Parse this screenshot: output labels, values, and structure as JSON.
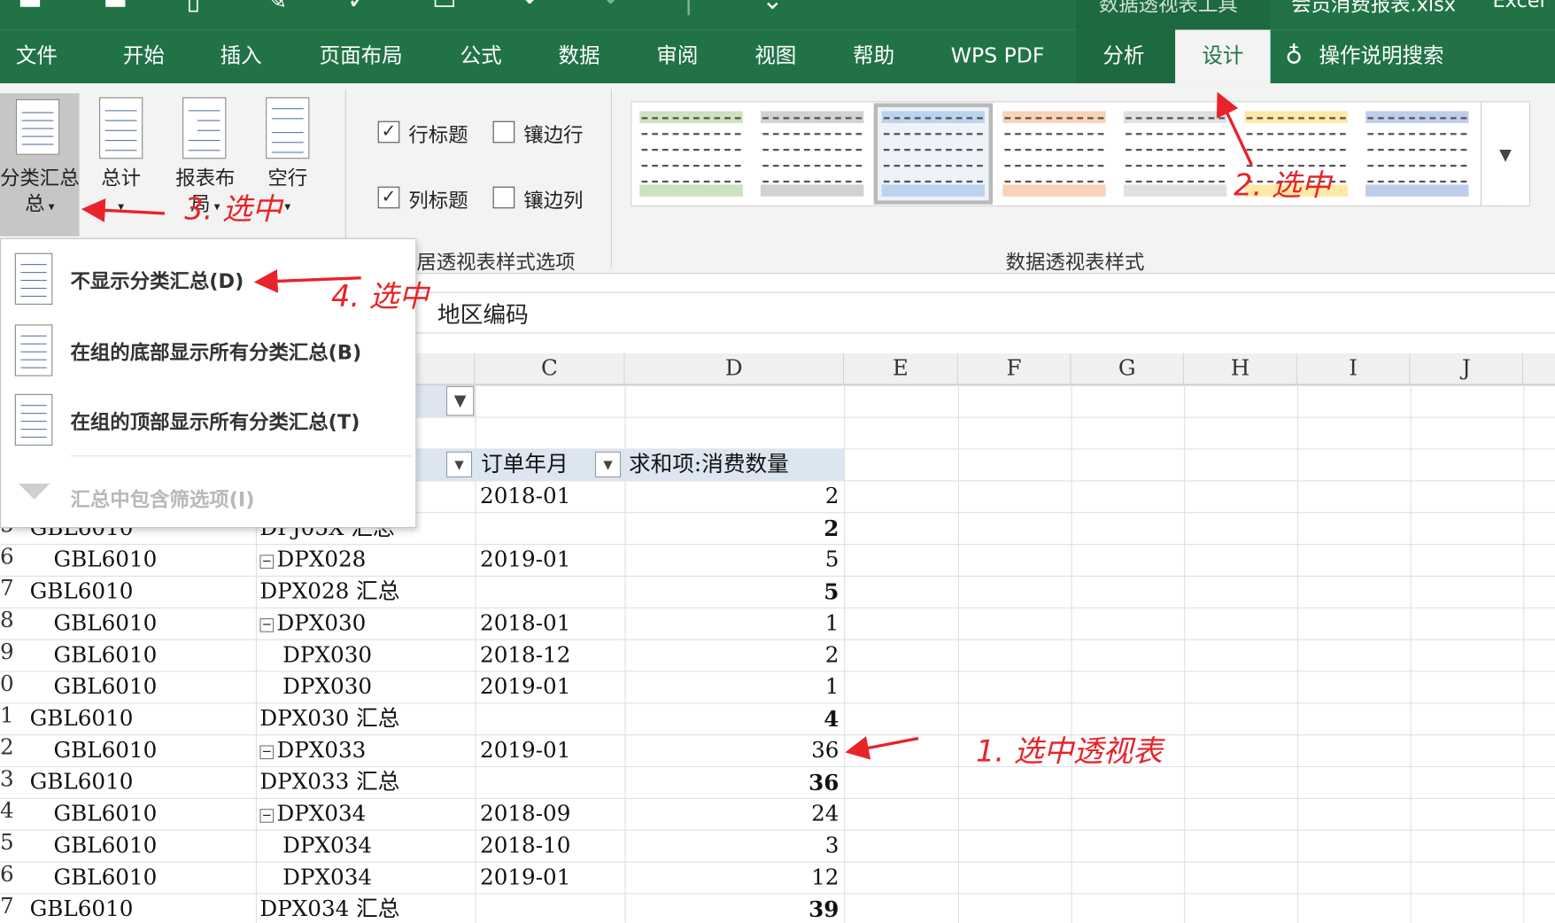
{
  "window": {
    "tool_context_title": "数据透视表工具",
    "file_title": "会员消费报表.xlsx",
    "app_name": "Excel"
  },
  "ribbon_tabs": [
    "文件",
    "开始",
    "插入",
    "页面布局",
    "公式",
    "数据",
    "审阅",
    "视图",
    "帮助",
    "WPS PDF",
    "分析",
    "设计"
  ],
  "active_tab": "设计",
  "tell_me": "操作说明搜索",
  "layout_group": {
    "subtotals": "分类汇总",
    "subtotals_line2": "总",
    "grand_totals": "总计",
    "report_layout": "报表布",
    "report_layout_line2": "局",
    "blank_rows": "空行"
  },
  "style_options": {
    "row_headers": "行标题",
    "row_headers_checked": true,
    "banded_rows": "镶边行",
    "banded_rows_checked": false,
    "column_headers": "列标题",
    "column_headers_checked": true,
    "banded_columns": "镶边列",
    "banded_columns_checked": false,
    "group_label": "数据透视表样式选项",
    "group_label_visible": "居透视表样式选项"
  },
  "styles_group": {
    "label": "数据透视表样式",
    "swatch_colors": [
      "#70ad47",
      "#7f7f7f",
      "#5b9bd5",
      "#ed7d31",
      "#a5a5a5",
      "#ffc000",
      "#4472c4"
    ],
    "more_icon": "chevron-down-icon"
  },
  "formula_bar": {
    "value": "地区编码"
  },
  "subtotal_menu": {
    "items": [
      {
        "label": "不显示分类汇总(D)",
        "enabled": true
      },
      {
        "label": "在组的底部显示所有分类汇总(B)",
        "enabled": true
      },
      {
        "label": "在组的顶部显示所有分类汇总(T)",
        "enabled": true
      },
      {
        "label": "汇总中包含筛选项(I)",
        "enabled": false
      }
    ]
  },
  "columns": [
    "C",
    "D",
    "E",
    "F",
    "G",
    "H",
    "I",
    "J"
  ],
  "pivot_headers": {
    "col_c": "订单年月",
    "col_d": "求和项:消费数量"
  },
  "rows": [
    {
      "num": "",
      "a": "",
      "b": "",
      "c": "2018-01",
      "d": "2",
      "bold": false
    },
    {
      "num": "5",
      "a": "GBL6010",
      "b": "DPJ05X 汇总",
      "c": "",
      "d": "2",
      "bold": true
    },
    {
      "num": "6",
      "a": "GBL6010",
      "b": "DPX028",
      "c": "2019-01",
      "d": "5",
      "bold": false,
      "collapse": true,
      "indent_a": true
    },
    {
      "num": "7",
      "a": "GBL6010",
      "b": "DPX028 汇总",
      "c": "",
      "d": "5",
      "bold": true
    },
    {
      "num": "8",
      "a": "GBL6010",
      "b": "DPX030",
      "c": "2018-01",
      "d": "1",
      "bold": false,
      "collapse": true,
      "indent_a": true
    },
    {
      "num": "9",
      "a": "GBL6010",
      "b": "DPX030",
      "c": "2018-12",
      "d": "2",
      "bold": false,
      "indent_a": true,
      "indent_b": true
    },
    {
      "num": "0",
      "a": "GBL6010",
      "b": "DPX030",
      "c": "2019-01",
      "d": "1",
      "bold": false,
      "indent_a": true,
      "indent_b": true
    },
    {
      "num": "1",
      "a": "GBL6010",
      "b": "DPX030 汇总",
      "c": "",
      "d": "4",
      "bold": true
    },
    {
      "num": "2",
      "a": "GBL6010",
      "b": "DPX033",
      "c": "2019-01",
      "d": "36",
      "bold": false,
      "collapse": true,
      "indent_a": true
    },
    {
      "num": "3",
      "a": "GBL6010",
      "b": "DPX033 汇总",
      "c": "",
      "d": "36",
      "bold": true
    },
    {
      "num": "4",
      "a": "GBL6010",
      "b": "DPX034",
      "c": "2018-09",
      "d": "24",
      "bold": false,
      "collapse": true,
      "indent_a": true
    },
    {
      "num": "5",
      "a": "GBL6010",
      "b": "DPX034",
      "c": "2018-10",
      "d": "3",
      "bold": false,
      "indent_a": true,
      "indent_b": true
    },
    {
      "num": "6",
      "a": "GBL6010",
      "b": "DPX034",
      "c": "2019-01",
      "d": "12",
      "bold": false,
      "indent_a": true,
      "indent_b": true
    },
    {
      "num": "7",
      "a": "GBL6010",
      "b": "DPX034 汇总",
      "c": "",
      "d": "39",
      "bold": true
    }
  ],
  "annotations": {
    "step1": "1. 选中透视表",
    "step2": "2. 选中",
    "step3": "3. 选中",
    "step4": "4. 选中",
    "color": "#e8232a"
  }
}
